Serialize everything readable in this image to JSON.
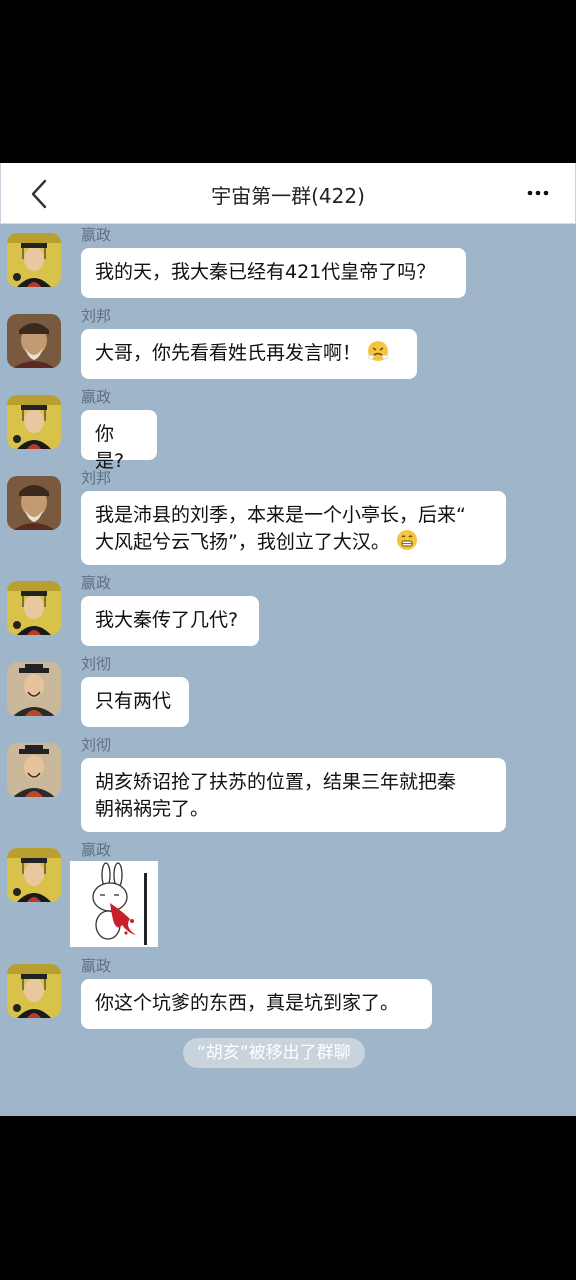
{
  "header": {
    "title": "宇宙第一群(422)",
    "back_icon": "chevron-left-icon",
    "more_icon": "more-dots-icon"
  },
  "messages": [
    {
      "sender": "嬴政",
      "text": "我的天，我大秦已经有421代皇帝了吗？",
      "avatar": "qin-emperor-avatar"
    },
    {
      "sender": "刘邦",
      "text": "大哥，你先看看姓氏再发言啊！",
      "avatar": "liu-bang-avatar",
      "emoji": "angry-steam-emoji"
    },
    {
      "sender": "嬴政",
      "text": "你是?",
      "avatar": "qin-emperor-avatar"
    },
    {
      "sender": "刘邦",
      "line1": "我是沛县的刘季，本来是一个小亭长，后来“",
      "line2": "大风起兮云飞扬”，我创立了大汉。",
      "avatar": "liu-bang-avatar",
      "emoji": "grin-emoji"
    },
    {
      "sender": "嬴政",
      "text": "我大秦传了几代?",
      "avatar": "qin-emperor-avatar"
    },
    {
      "sender": "刘彻",
      "text": "只有两代",
      "avatar": "han-emperor-avatar"
    },
    {
      "sender": "刘彻",
      "line1": "胡亥矫诏抢了扶苏的位置，结果三年就把秦",
      "line2": "朝祸祸完了。",
      "avatar": "han-emperor-avatar"
    },
    {
      "sender": "嬴政",
      "sticker": "rabbit-spitting-blood-sticker",
      "avatar": "qin-emperor-avatar"
    },
    {
      "sender": "嬴政",
      "text": "你这个坑爹的东西，真是坑到家了。",
      "avatar": "qin-emperor-avatar"
    }
  ],
  "system_notice": "“胡亥”被移出了群聊",
  "colors": {
    "chat_background": "#9fb5c9",
    "bubble": "#ffffff",
    "notice_background": "#c9d3dc"
  }
}
